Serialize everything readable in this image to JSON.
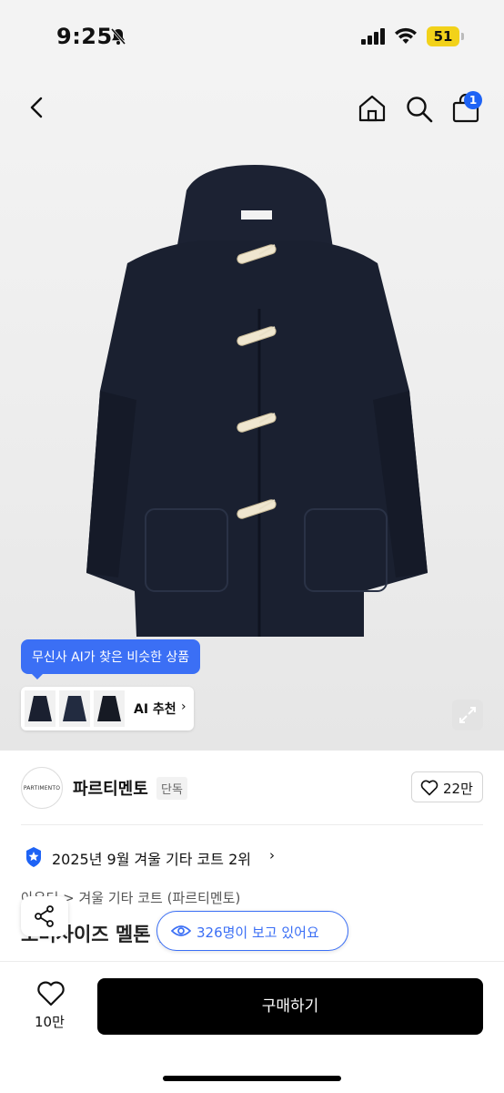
{
  "status_bar": {
    "time": "9:25",
    "battery": "51"
  },
  "nav": {
    "cart_count": "1",
    "icons": [
      "back-icon",
      "home-icon",
      "search-icon",
      "cart-icon"
    ]
  },
  "ai": {
    "tooltip": "무신사 AI가 찾은 비슷한 상품",
    "button_label": "AI 추천",
    "arrow": "›"
  },
  "brand": {
    "logo_text": "PARTIMENTO",
    "name": "파르티멘토",
    "tag": "단독",
    "likes": "22만"
  },
  "rank": {
    "text": "2025년 9월 겨울 기타 코트 2위",
    "arrow": "›"
  },
  "breadcrumb": {
    "text": "아우터 > 겨울 기타 코트 (파르티멘토)"
  },
  "product": {
    "title": "오버사이즈 멜톤 울 더플 코트"
  },
  "viewers": {
    "text": "326명이 보고 있어요"
  },
  "bottom_bar": {
    "wish_count": "10만",
    "buy_label": "구매하기"
  },
  "colors": {
    "accent": "#3b6ff5",
    "coat": "#1a2030",
    "badge": "#1e63f5"
  }
}
